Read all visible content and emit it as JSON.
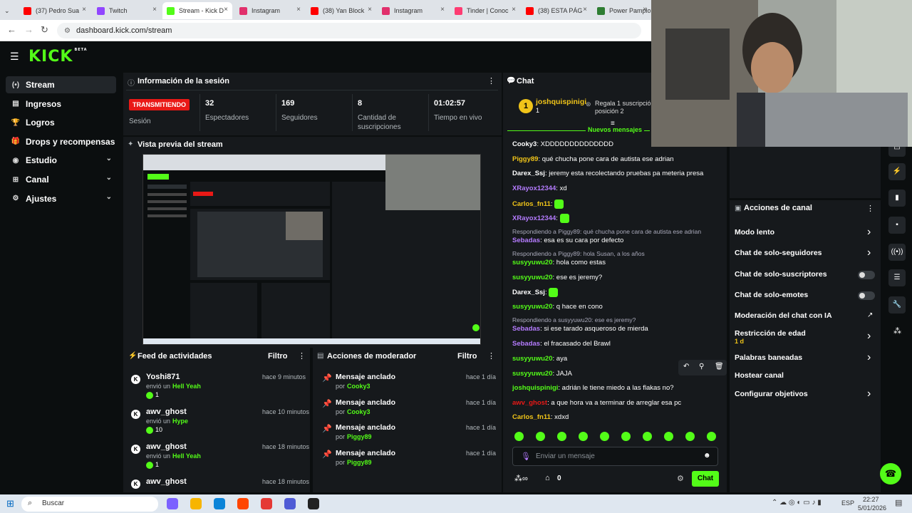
{
  "browser": {
    "tabs": [
      {
        "label": "(37) Pedro Sua",
        "color": "#ff0000"
      },
      {
        "label": "Twitch",
        "color": "#9146ff"
      },
      {
        "label": "Stream - Kick D",
        "color": "#53fc18",
        "active": true
      },
      {
        "label": "Instagram",
        "color": "#e1306c"
      },
      {
        "label": "(38) Yan Block",
        "color": "#ff0000"
      },
      {
        "label": "Instagram",
        "color": "#e1306c"
      },
      {
        "label": "Tinder | Conoc",
        "color": "#fe3c72"
      },
      {
        "label": "(38) ESTA PÁG",
        "color": "#ff0000"
      },
      {
        "label": "Power Pamplo",
        "color": "#2e7d32"
      }
    ],
    "url": "dashboard.kick.com/stream"
  },
  "header": {
    "logo": "KICK",
    "logo_tag": "BETA"
  },
  "sidebar": {
    "items": [
      {
        "label": "Stream",
        "icon": "stream-icon"
      },
      {
        "label": "Ingresos",
        "icon": "wallet-icon"
      },
      {
        "label": "Logros",
        "icon": "trophy-icon"
      },
      {
        "label": "Drops y recompensas",
        "icon": "gift-icon"
      },
      {
        "label": "Estudio",
        "icon": "studio-icon"
      },
      {
        "label": "Canal",
        "icon": "channel-icon"
      },
      {
        "label": "Ajustes",
        "icon": "gear-icon"
      }
    ]
  },
  "session": {
    "title": "Información de la sesión",
    "badge": "TRANSMITIENDO",
    "badge_label": "Sesión",
    "stats": [
      {
        "value": "32",
        "label": "Espectadores"
      },
      {
        "value": "169",
        "label": "Seguidores"
      },
      {
        "value": "8",
        "label": "Cantidad de suscripciones"
      },
      {
        "value": "01:02:57",
        "label": "Tiempo en vivo"
      }
    ]
  },
  "preview": {
    "title": "Vista previa del stream"
  },
  "feed": {
    "title": "Feed de actividades",
    "filter": "Filtro",
    "items": [
      {
        "name": "Yoshi871",
        "time": "hace 9 minutos",
        "action": "envió un",
        "item": "Hell Yeah",
        "count": "1"
      },
      {
        "name": "awv_ghost",
        "time": "hace 10 minutos",
        "action": "envió un",
        "item": "Hype",
        "count": "10"
      },
      {
        "name": "awv_ghost",
        "time": "hace 18 minutos",
        "action": "envió un",
        "item": "Hell Yeah",
        "count": "1"
      },
      {
        "name": "awv_ghost",
        "time": "hace 18 minutos"
      }
    ]
  },
  "modactions": {
    "title": "Acciones de moderador",
    "filter": "Filtro",
    "items": [
      {
        "title": "Mensaje anclado",
        "by": "por",
        "user": "Cooky3",
        "time": "hace 1 día"
      },
      {
        "title": "Mensaje anclado",
        "by": "por",
        "user": "Cooky3",
        "time": "hace 1 día"
      },
      {
        "title": "Mensaje anclado",
        "by": "por",
        "user": "Piggy89",
        "time": "hace 1 día"
      },
      {
        "title": "Mensaje anclado",
        "by": "por",
        "user": "Piggy89",
        "time": "hace 1 día"
      }
    ]
  },
  "chat": {
    "title": "Chat",
    "pinned_user": "joshquispinigi",
    "pinned_count": "1",
    "pinned_text": "Regala 1 suscripción",
    "pinned_pos": "posición 2",
    "new_messages": "Nuevos mensajes",
    "messages": [
      {
        "user": "Cooky3",
        "color": "#ffffff",
        "text": "XDDDDDDDDDDDDDD"
      },
      {
        "user": "Piggy89",
        "color": "#f0c419",
        "text": "qué chucha pone cara de autista ese adrian"
      },
      {
        "user": "Darex_Ssj",
        "color": "#ffffff",
        "text": "jeremy esta recolectando pruebas pa meteria presa"
      },
      {
        "user": "XRayox12344",
        "color": "#b57cff",
        "text": "xd"
      },
      {
        "user": "Carlos_fn11",
        "color": "#f0c419",
        "text": ""
      },
      {
        "user": "XRayox12344",
        "color": "#b57cff",
        "text": ""
      },
      {
        "reply": "Respondiendo a Piggy89: qué chucha pone cara de autista ese adrian"
      },
      {
        "user": "Sebadas",
        "color": "#b57cff",
        "text": "esa es su cara por defecto"
      },
      {
        "reply": "Respondiendo a Piggy89: hola Susan, a los años"
      },
      {
        "user": "susyyuwu20",
        "color": "#53fc18",
        "text": "hola como estas"
      },
      {
        "user": "susyyuwu20",
        "color": "#53fc18",
        "text": "ese es jeremy?"
      },
      {
        "user": "Darex_Ssj",
        "color": "#ffffff",
        "text": ""
      },
      {
        "user": "susyyuwu20",
        "color": "#53fc18",
        "text": "q hace en cono"
      },
      {
        "reply": "Respondiendo a susyyuwu20: ese es jeremy?"
      },
      {
        "user": "Sebadas",
        "color": "#b57cff",
        "text": "si ese tarado asqueroso de mierda"
      },
      {
        "user": "Sebadas",
        "color": "#b57cff",
        "text": "el fracasado del Brawl"
      },
      {
        "user": "susyyuwu20",
        "color": "#53fc18",
        "text": "aya"
      },
      {
        "user": "susyyuwu20",
        "color": "#53fc18",
        "text": "JAJA"
      },
      {
        "user": "joshquispinigi",
        "color": "#53fc18",
        "text": "adrián le tiene miedo a las flakas no?"
      },
      {
        "user": "awv_ghost",
        "color": "#e91916",
        "text": "a que hora va a terminar de arreglar esa pc"
      },
      {
        "user": "Carlos_fn11",
        "color": "#f0c419",
        "text": "xdxd"
      }
    ],
    "input_placeholder": "Enviar un mensaje",
    "points": "0",
    "send_label": "Chat"
  },
  "channel_actions": {
    "title": "Acciones de canal",
    "items": [
      {
        "label": "Modo lento",
        "type": "chevron"
      },
      {
        "label": "Chat de solo-seguidores",
        "type": "chevron"
      },
      {
        "label": "Chat de solo-suscriptores",
        "type": "toggle"
      },
      {
        "label": "Chat de solo-emotes",
        "type": "toggle"
      },
      {
        "label": "Moderación del chat con IA",
        "type": "link"
      },
      {
        "label": "Restricción de edad",
        "sub": "1 d",
        "type": "chevron"
      },
      {
        "label": "Palabras baneadas",
        "type": "chevron"
      },
      {
        "label": "Hostear canal",
        "type": "none"
      },
      {
        "label": "Configurar objetivos",
        "type": "chevron"
      }
    ]
  },
  "taskbar": {
    "search": "Buscar",
    "lang": "ESP",
    "time": "22:27",
    "date": "5/01/2026"
  }
}
